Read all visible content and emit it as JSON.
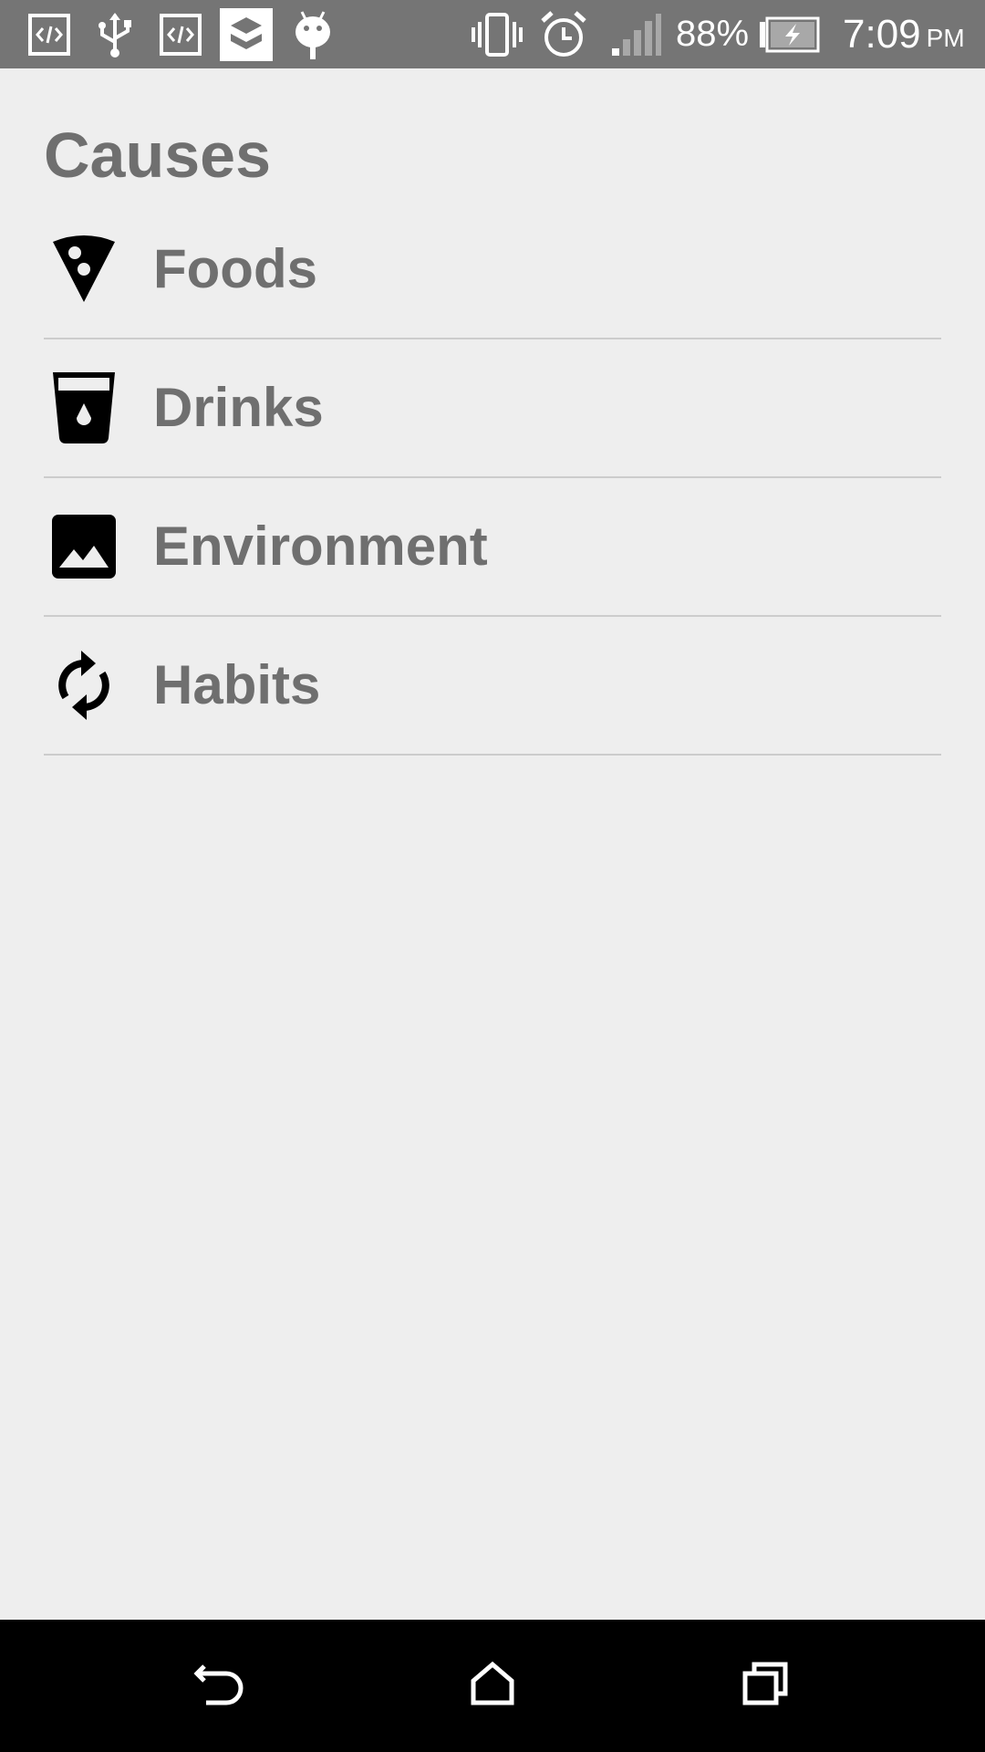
{
  "status_bar": {
    "battery_percent": "88%",
    "time": "7:09",
    "ampm": "PM",
    "left_icons": [
      "code-icon",
      "usb-icon",
      "code-icon",
      "layers-app-icon",
      "android-icon"
    ],
    "right_icons": [
      "vibrate-icon",
      "alarm-icon",
      "signal-icon",
      "battery-charging-icon"
    ],
    "background_color": "#757575"
  },
  "page": {
    "title": "Causes",
    "background_color": "#eeeeee",
    "text_color": "#6f6f6f"
  },
  "causes": [
    {
      "label": "Foods",
      "icon": "pizza-slice-icon"
    },
    {
      "label": "Drinks",
      "icon": "drink-cup-icon"
    },
    {
      "label": "Environment",
      "icon": "landscape-image-icon"
    },
    {
      "label": "Habits",
      "icon": "refresh-cycle-icon"
    }
  ],
  "nav_bar": {
    "buttons": [
      "back-icon",
      "home-icon",
      "recent-apps-icon"
    ],
    "background_color": "#000000"
  }
}
